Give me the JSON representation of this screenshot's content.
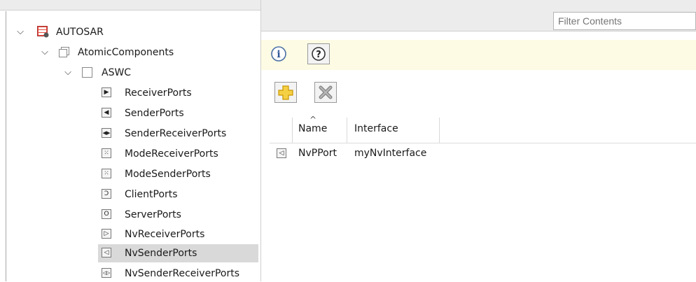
{
  "tree": {
    "root": {
      "label": "AUTOSAR"
    },
    "atomic": {
      "label": "AtomicComponents"
    },
    "component": {
      "label": "ASWC"
    },
    "port_types": [
      {
        "label": "ReceiverPorts",
        "glyph": "▶"
      },
      {
        "label": "SenderPorts",
        "glyph": "◀"
      },
      {
        "label": "SenderReceiverPorts",
        "glyph": "◀▶"
      },
      {
        "label": "ModeReceiverPorts",
        "glyph": "⁙"
      },
      {
        "label": "ModeSenderPorts",
        "glyph": "⁙"
      },
      {
        "label": "ClientPorts",
        "glyph": "Ↄ"
      },
      {
        "label": "ServerPorts",
        "glyph": "O"
      },
      {
        "label": "NvReceiverPorts",
        "glyph": "▷"
      },
      {
        "label": "NvSenderPorts",
        "glyph": "◁"
      },
      {
        "label": "NvSenderReceiverPorts",
        "glyph": "◁▷"
      }
    ],
    "selected": "NvSenderPorts"
  },
  "filter": {
    "placeholder": "Filter Contents"
  },
  "info_bar": {
    "info_icon": "info-icon",
    "help_icon": "help-icon"
  },
  "toolbar": {
    "add_icon": "add-icon",
    "delete_icon": "delete-icon"
  },
  "table": {
    "columns": [
      "Name",
      "Interface"
    ],
    "sorted_column": "Name",
    "rows": [
      {
        "icon": "nv-sender-port-icon",
        "name": "NvPPort",
        "interface": "myNvInterface"
      }
    ]
  },
  "colors": {
    "info_bar_bg": "#fdfbe3",
    "selection_bg": "#d9d9d9",
    "add_icon": "#f2c21b",
    "delete_icon": "#8a8a8a"
  }
}
